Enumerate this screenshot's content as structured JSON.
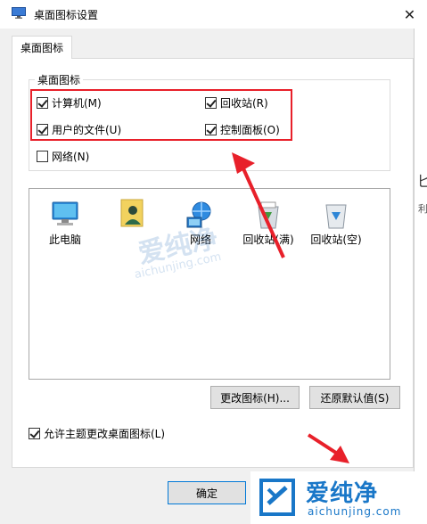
{
  "window": {
    "title": "桌面图标设置",
    "close_glyph": "✕"
  },
  "tab": {
    "label": "桌面图标"
  },
  "group": {
    "legend": "桌面图标",
    "checkboxes": [
      {
        "label": "计算机(M)",
        "checked": true
      },
      {
        "label": "回收站(R)",
        "checked": true
      },
      {
        "label": "用户的文件(U)",
        "checked": true
      },
      {
        "label": "控制面板(O)",
        "checked": true
      },
      {
        "label": "网络(N)",
        "checked": false
      }
    ]
  },
  "icons": [
    {
      "label": "此电脑",
      "icon": "computer-icon"
    },
    {
      "label": "",
      "icon": "user-folder-icon"
    },
    {
      "label": "网络",
      "icon": "network-icon"
    },
    {
      "label": "回收站(满)",
      "icon": "recycle-bin-full-icon"
    },
    {
      "label": "回收站(空)",
      "icon": "recycle-bin-empty-icon"
    }
  ],
  "buttons": {
    "change_icon": "更改图标(H)...",
    "restore_default": "还原默认值(S)",
    "ok": "确定"
  },
  "allow_theme": {
    "label": "允许主题更改桌面图标(L)",
    "checked": true
  },
  "watermark": {
    "cn": "爱纯净",
    "en": "aichunjing.com"
  },
  "background_fragments": {
    "frag1": "匕",
    "frag2": "利"
  },
  "colors": {
    "highlight": "#e8202a",
    "accent": "#0078d7",
    "watermark": "#1977c8"
  }
}
